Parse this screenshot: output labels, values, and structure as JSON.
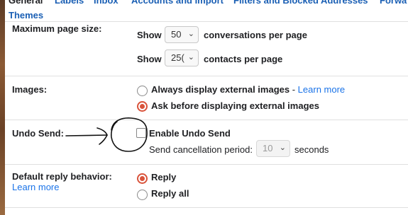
{
  "tabs": [
    "General",
    "Labels",
    "Inbox",
    "Accounts and Import",
    "Filters and Blocked Addresses",
    "Forwa"
  ],
  "themes_tab": "Themes",
  "max_page_size": {
    "label": "Maximum page size:",
    "show1": "Show",
    "conversations_value": "50",
    "conversations_text": "conversations per page",
    "show2": "Show",
    "contacts_value": "25(",
    "contacts_text": "contacts per page"
  },
  "images": {
    "label": "Images:",
    "option1": "Always display external images",
    "option1_sep": " - ",
    "learn_more": "Learn more",
    "option2": "Ask before displaying external images",
    "selected": 2
  },
  "undo_send": {
    "label": "Undo Send:",
    "checkbox_label": "Enable Undo Send",
    "checked": false,
    "period_label": "Send cancellation period:",
    "period_value": "10",
    "period_unit": "seconds"
  },
  "reply": {
    "label": "Default reply behavior:",
    "learn_more": "Learn more",
    "option1": "Reply",
    "option2": "Reply all",
    "selected": 1
  },
  "icons": {
    "select_chevron": "chevron-down-icon",
    "annotation": "hand-drawn-arrow-icon"
  },
  "colors": {
    "link": "#1a73e8",
    "radio_selected": "#d9533b"
  }
}
